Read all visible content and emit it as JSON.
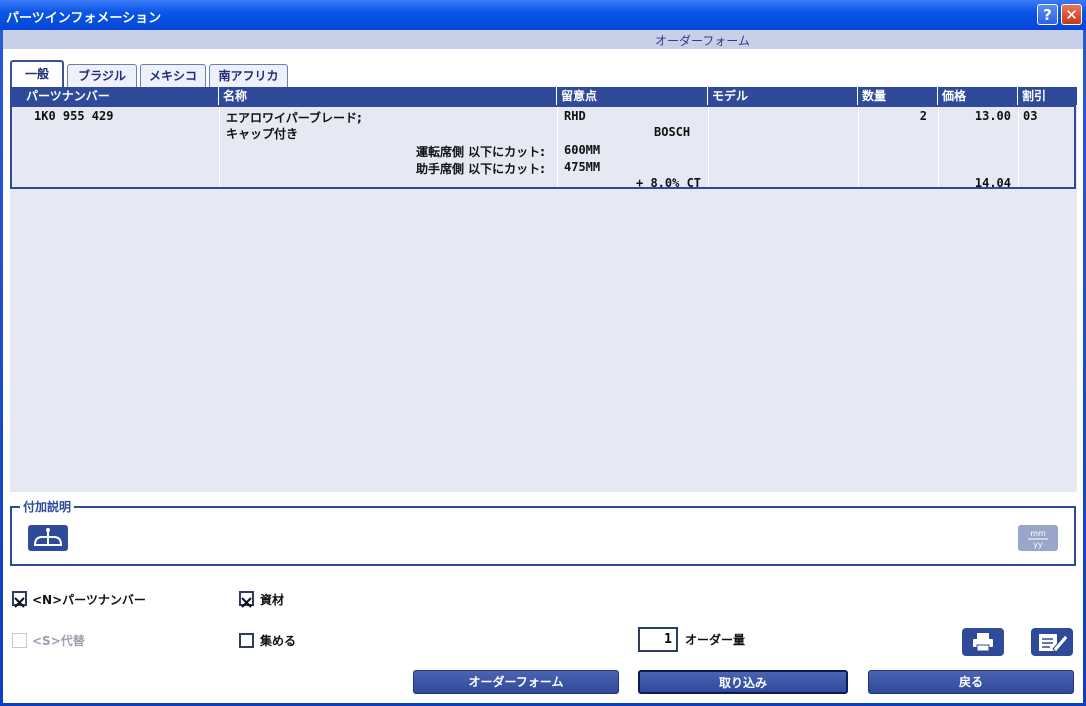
{
  "window": {
    "title": "パーツインフォメーション"
  },
  "header": {
    "title": "オーダーフォーム"
  },
  "tabs": [
    {
      "label": "一般",
      "active": true
    },
    {
      "label": "ブラジル",
      "active": false
    },
    {
      "label": "メキシコ",
      "active": false
    },
    {
      "label": "南アフリカ",
      "active": false
    }
  ],
  "table": {
    "columns": [
      "パーツナンバー",
      "名称",
      "留意点",
      "モデル",
      "数量",
      "価格",
      "割引"
    ],
    "row": {
      "part_number": "1K0 955 429",
      "name_line1": "エアロワイパーブレード;",
      "name_line2": "キャップ付き",
      "driver_label": "運転席側 以下にカット:",
      "passenger_label": "助手席側 以下にカット:",
      "note_rhd": "RHD",
      "note_brand": "BOSCH",
      "note_driver": "600MM",
      "note_passenger": "475MM",
      "note_extra": "+ 8.0% CT",
      "model": "",
      "quantity": "2",
      "price": "13.00",
      "price2": "14.04",
      "discount": "03"
    }
  },
  "additional": {
    "legend": "付加説明",
    "left_icon": "scale-balance-icon",
    "right_icon": "date-mm-yy-icon",
    "date_mm": "mm",
    "date_yy": "yy"
  },
  "options": {
    "part_number_label": "<N>パーツナンバー",
    "part_number_checked": true,
    "material_label": "資材",
    "material_checked": true,
    "substitute_label": "<S>代替",
    "substitute_checked": false,
    "collect_label": "集める",
    "collect_checked": false
  },
  "order_qty": {
    "value": "1",
    "label": "オーダー量"
  },
  "buttons": {
    "order_form": "オーダーフォーム",
    "import": "取り込み",
    "back": "戻る"
  },
  "colors": {
    "accent": "#2e4a99",
    "titlebar": "#0a56e6",
    "grid_bg": "#e6e9f3"
  }
}
